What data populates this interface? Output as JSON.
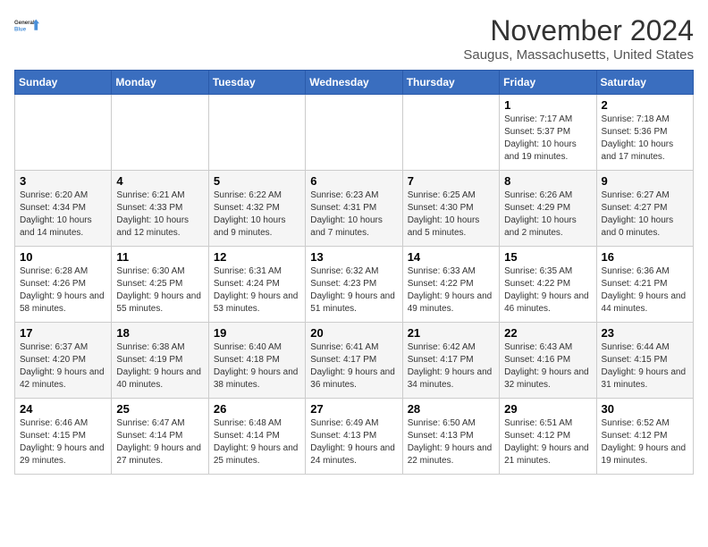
{
  "header": {
    "logo_line1": "General",
    "logo_line2": "Blue",
    "month": "November 2024",
    "location": "Saugus, Massachusetts, United States"
  },
  "days_of_week": [
    "Sunday",
    "Monday",
    "Tuesday",
    "Wednesday",
    "Thursday",
    "Friday",
    "Saturday"
  ],
  "weeks": [
    [
      {
        "day": "",
        "info": ""
      },
      {
        "day": "",
        "info": ""
      },
      {
        "day": "",
        "info": ""
      },
      {
        "day": "",
        "info": ""
      },
      {
        "day": "",
        "info": ""
      },
      {
        "day": "1",
        "info": "Sunrise: 7:17 AM\nSunset: 5:37 PM\nDaylight: 10 hours and 19 minutes."
      },
      {
        "day": "2",
        "info": "Sunrise: 7:18 AM\nSunset: 5:36 PM\nDaylight: 10 hours and 17 minutes."
      }
    ],
    [
      {
        "day": "3",
        "info": "Sunrise: 6:20 AM\nSunset: 4:34 PM\nDaylight: 10 hours and 14 minutes."
      },
      {
        "day": "4",
        "info": "Sunrise: 6:21 AM\nSunset: 4:33 PM\nDaylight: 10 hours and 12 minutes."
      },
      {
        "day": "5",
        "info": "Sunrise: 6:22 AM\nSunset: 4:32 PM\nDaylight: 10 hours and 9 minutes."
      },
      {
        "day": "6",
        "info": "Sunrise: 6:23 AM\nSunset: 4:31 PM\nDaylight: 10 hours and 7 minutes."
      },
      {
        "day": "7",
        "info": "Sunrise: 6:25 AM\nSunset: 4:30 PM\nDaylight: 10 hours and 5 minutes."
      },
      {
        "day": "8",
        "info": "Sunrise: 6:26 AM\nSunset: 4:29 PM\nDaylight: 10 hours and 2 minutes."
      },
      {
        "day": "9",
        "info": "Sunrise: 6:27 AM\nSunset: 4:27 PM\nDaylight: 10 hours and 0 minutes."
      }
    ],
    [
      {
        "day": "10",
        "info": "Sunrise: 6:28 AM\nSunset: 4:26 PM\nDaylight: 9 hours and 58 minutes."
      },
      {
        "day": "11",
        "info": "Sunrise: 6:30 AM\nSunset: 4:25 PM\nDaylight: 9 hours and 55 minutes."
      },
      {
        "day": "12",
        "info": "Sunrise: 6:31 AM\nSunset: 4:24 PM\nDaylight: 9 hours and 53 minutes."
      },
      {
        "day": "13",
        "info": "Sunrise: 6:32 AM\nSunset: 4:23 PM\nDaylight: 9 hours and 51 minutes."
      },
      {
        "day": "14",
        "info": "Sunrise: 6:33 AM\nSunset: 4:22 PM\nDaylight: 9 hours and 49 minutes."
      },
      {
        "day": "15",
        "info": "Sunrise: 6:35 AM\nSunset: 4:22 PM\nDaylight: 9 hours and 46 minutes."
      },
      {
        "day": "16",
        "info": "Sunrise: 6:36 AM\nSunset: 4:21 PM\nDaylight: 9 hours and 44 minutes."
      }
    ],
    [
      {
        "day": "17",
        "info": "Sunrise: 6:37 AM\nSunset: 4:20 PM\nDaylight: 9 hours and 42 minutes."
      },
      {
        "day": "18",
        "info": "Sunrise: 6:38 AM\nSunset: 4:19 PM\nDaylight: 9 hours and 40 minutes."
      },
      {
        "day": "19",
        "info": "Sunrise: 6:40 AM\nSunset: 4:18 PM\nDaylight: 9 hours and 38 minutes."
      },
      {
        "day": "20",
        "info": "Sunrise: 6:41 AM\nSunset: 4:17 PM\nDaylight: 9 hours and 36 minutes."
      },
      {
        "day": "21",
        "info": "Sunrise: 6:42 AM\nSunset: 4:17 PM\nDaylight: 9 hours and 34 minutes."
      },
      {
        "day": "22",
        "info": "Sunrise: 6:43 AM\nSunset: 4:16 PM\nDaylight: 9 hours and 32 minutes."
      },
      {
        "day": "23",
        "info": "Sunrise: 6:44 AM\nSunset: 4:15 PM\nDaylight: 9 hours and 31 minutes."
      }
    ],
    [
      {
        "day": "24",
        "info": "Sunrise: 6:46 AM\nSunset: 4:15 PM\nDaylight: 9 hours and 29 minutes."
      },
      {
        "day": "25",
        "info": "Sunrise: 6:47 AM\nSunset: 4:14 PM\nDaylight: 9 hours and 27 minutes."
      },
      {
        "day": "26",
        "info": "Sunrise: 6:48 AM\nSunset: 4:14 PM\nDaylight: 9 hours and 25 minutes."
      },
      {
        "day": "27",
        "info": "Sunrise: 6:49 AM\nSunset: 4:13 PM\nDaylight: 9 hours and 24 minutes."
      },
      {
        "day": "28",
        "info": "Sunrise: 6:50 AM\nSunset: 4:13 PM\nDaylight: 9 hours and 22 minutes."
      },
      {
        "day": "29",
        "info": "Sunrise: 6:51 AM\nSunset: 4:12 PM\nDaylight: 9 hours and 21 minutes."
      },
      {
        "day": "30",
        "info": "Sunrise: 6:52 AM\nSunset: 4:12 PM\nDaylight: 9 hours and 19 minutes."
      }
    ]
  ]
}
